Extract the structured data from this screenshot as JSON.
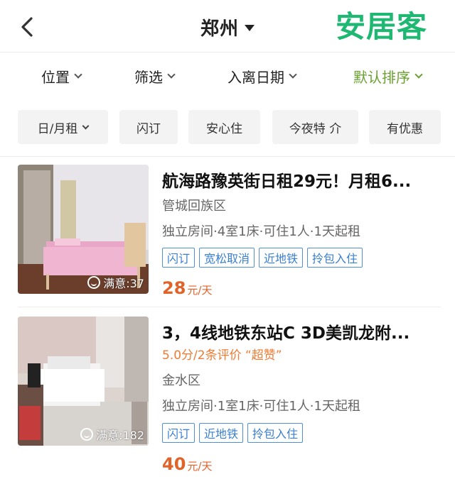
{
  "header": {
    "back_icon": "chevron-left-icon",
    "city": "郑州",
    "logo": "安居客",
    "brand_color": "#1fb873"
  },
  "filters": [
    {
      "label": "位置"
    },
    {
      "label": "筛选"
    },
    {
      "label": "入离日期"
    },
    {
      "label": "默认排序",
      "active": true,
      "color": "#69a130"
    }
  ],
  "tags": [
    {
      "label": "日/月租",
      "dropdown": true
    },
    {
      "label": "闪订"
    },
    {
      "label": "安心住"
    },
    {
      "label": "今夜特 介"
    },
    {
      "label": "有优惠"
    }
  ],
  "listings": [
    {
      "title": "航海路豫英街日租29元！月租6...",
      "district": "管城回族区",
      "specs": "独立房间·4室1床·可住1人·1天起租",
      "badges": [
        "闪订",
        "宽松取消",
        "近地铁",
        "拎包入住"
      ],
      "satisfaction": "满意:37",
      "price": "28",
      "unit": "元/天"
    },
    {
      "title": "3，4线地铁东站C 3D美凯龙附...",
      "score": "5.0分/2条评价 “超赞”",
      "district": "金水区",
      "specs": "独立房间·1室1床·可住1人·1天起租",
      "badges": [
        "闪订",
        "近地铁",
        "拎包入住"
      ],
      "satisfaction": "满意:182",
      "price": "40",
      "unit": "元/天"
    }
  ],
  "colors": {
    "price": "#e0632a",
    "badge": "#3a7fd1",
    "score": "#f07b33"
  }
}
